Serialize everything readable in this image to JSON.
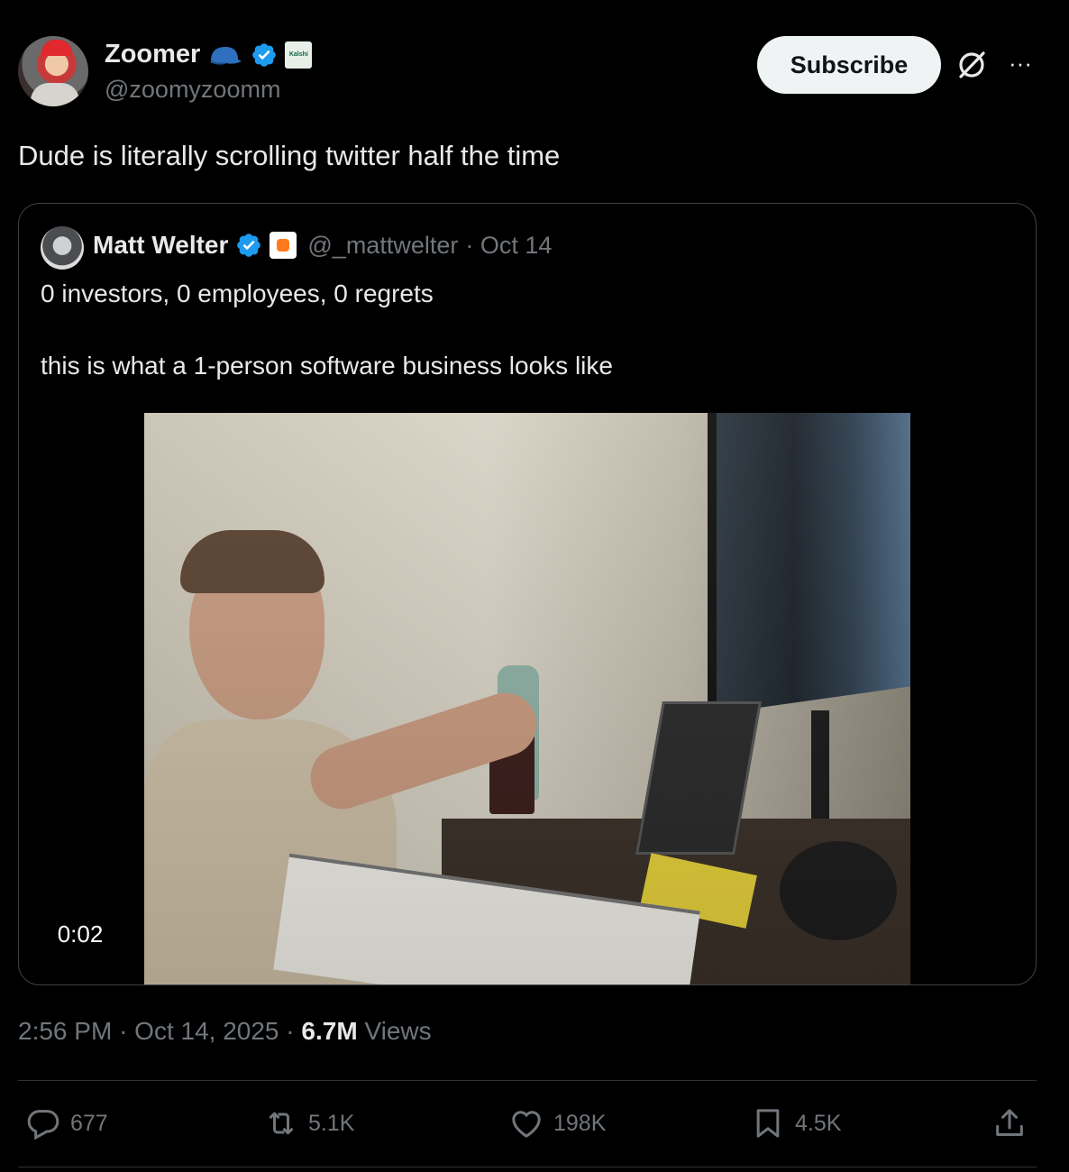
{
  "author": {
    "name": "Zoomer",
    "handle": "@zoomyzoomm",
    "affiliate_badge_text": "Kalshi"
  },
  "subscribe_label": "Subscribe",
  "tweet_text": "Dude is literally scrolling twitter half the time",
  "quoted": {
    "name": "Matt Welter",
    "handle": "@_mattwelter",
    "date": "· Oct 14",
    "line1": "0 investors, 0 employees, 0 regrets",
    "line2": "this is what a 1-person software business looks like",
    "video_time": "0:02"
  },
  "meta": {
    "time": "2:56 PM",
    "date": "Oct 14, 2025",
    "views_count": "6.7M",
    "views_label": "Views"
  },
  "actions": {
    "replies": "677",
    "reposts": "5.1K",
    "likes": "198K",
    "bookmarks": "4.5K"
  },
  "colors": {
    "background": "#000000",
    "text": "#e7e9ea",
    "muted": "#71767b",
    "verified": "#1d9bf0",
    "border": "#2f3336"
  },
  "icons": [
    "cap-badge-icon",
    "verified-icon",
    "kalshi-badge-icon",
    "grok-icon",
    "more-icon",
    "reply-icon",
    "repost-icon",
    "like-icon",
    "bookmark-icon",
    "share-icon"
  ]
}
